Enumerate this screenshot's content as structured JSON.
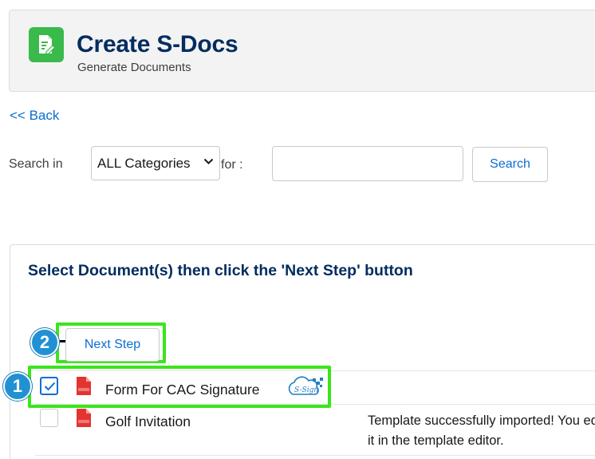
{
  "header": {
    "title": "Create S-Docs",
    "subtitle": "Generate Documents",
    "icon": "document-edit-icon",
    "icon_color": "#3bba4c"
  },
  "back_link": "<< Back",
  "search": {
    "search_in_label": "Search in",
    "category_selected": "ALL Categories",
    "for_label": "for :",
    "query_value": "",
    "query_placeholder": "",
    "button_label": "Search"
  },
  "card": {
    "instruction": "Select Document(s) then click the 'Next Step' button",
    "next_step_label": "Next Step",
    "markers": [
      "2",
      "1"
    ],
    "documents": [
      {
        "name": "Form For CAC Signature",
        "checked": true,
        "status": "",
        "badge": "S-Sign"
      },
      {
        "name": "Golf Invitation",
        "checked": false,
        "status": "Template successfully imported! You edit it in the template editor."
      }
    ]
  },
  "colors": {
    "title": "#032d60",
    "link": "#0b6ed3",
    "highlight": "#39e61a",
    "marker": "#2291d3",
    "pdf": "#e3342f"
  }
}
